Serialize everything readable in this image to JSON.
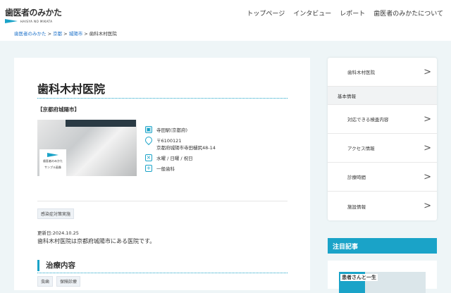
{
  "header": {
    "logo_text": "歯医者のみかた",
    "logo_roman": "HAISYA NO MIKATA",
    "nav": [
      "トップページ",
      "インタビュー",
      "レポート",
      "歯医者のみかたについて"
    ]
  },
  "breadcrumb": [
    "歯医者のみかた",
    "京都",
    "城陽市",
    "歯科木村医院"
  ],
  "clinic": {
    "name": "歯科木村医院",
    "prefecture": "【京都府城陽市】",
    "photo_label": "歯医者のみかた",
    "photo_sub": "サンプル画像",
    "station": "寺田駅(京都府)",
    "postal": "〒6100121",
    "address": "京都府城陽市寺田樋尻48-14",
    "closed": "水曜 / 日曜 / 祝日",
    "department": "一般歯科",
    "feature_tag": "感染症対策実施",
    "updated": "更新日:2024.10.25",
    "description": "歯科木村医院は京都府城陽市にある医院です。"
  },
  "treatment": {
    "heading": "治療内容",
    "tags": [
      "虫歯",
      "保険診療"
    ]
  },
  "sidebar": {
    "top": "歯科木村医院",
    "section": "基本情報",
    "items": [
      "対応できる検査内容",
      "アクセス情報",
      "診療時間",
      "施設情報"
    ]
  },
  "featured": {
    "heading": "注目記事",
    "article_caption": "患者さんと一生"
  }
}
